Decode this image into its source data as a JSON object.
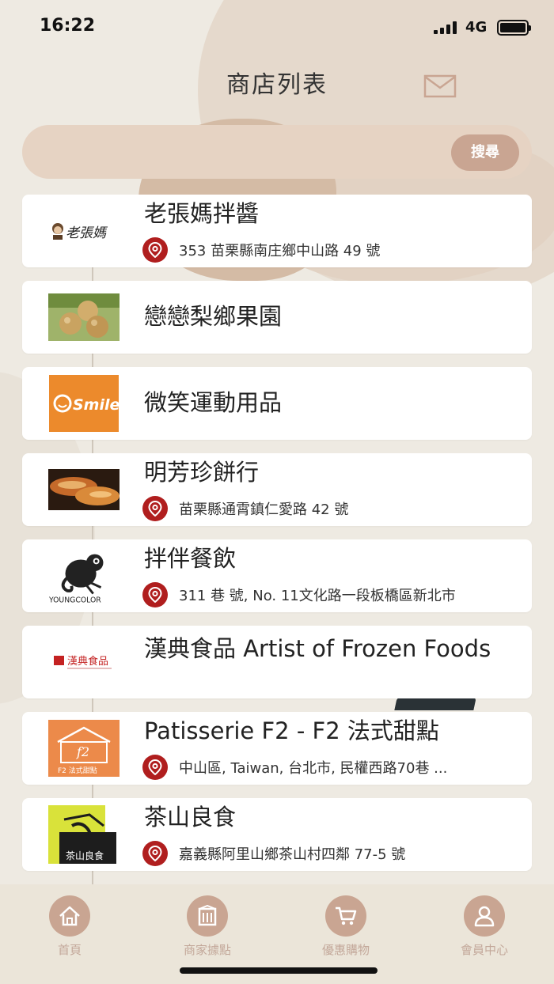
{
  "status": {
    "time": "16:22",
    "network": "4G"
  },
  "header": {
    "title": "商店列表",
    "mail_icon": "mail-icon"
  },
  "search": {
    "value": "",
    "placeholder": "",
    "button": "搜尋"
  },
  "stores": [
    {
      "name": "老張媽拌醬",
      "address": "353 苗栗縣南庄鄉中山路 49 號",
      "logo": "laozhangma-logo",
      "logo_text": "老張媽"
    },
    {
      "name": "戀戀梨鄉果園",
      "address": "",
      "logo": "pear-photo"
    },
    {
      "name": "微笑運動用品",
      "address": "",
      "logo": "smile-logo",
      "logo_text": "Smile"
    },
    {
      "name": "明芳珍餅行",
      "address": "苗栗縣通霄鎮仁愛路 42 號",
      "logo": "pastry-photo"
    },
    {
      "name": "拌伴餐飲",
      "address": "311 巷 號, No. 11文化路一段板橋區新北市",
      "logo": "youngcolor-logo",
      "logo_text": "YOUNGCOLOR"
    },
    {
      "name": "漢典食品 Artist of Frozen Foods",
      "address": "",
      "logo": "handian-logo",
      "logo_text": "漢典食品"
    },
    {
      "name": "Patisserie F2 - F2 法式甜點",
      "address": "中山區, Taiwan, 台北市, 民權西路70巷 ...",
      "logo": "f2-logo",
      "logo_text": "F2 法式甜點"
    },
    {
      "name": "茶山良食",
      "address": "嘉義縣阿里山鄉茶山村四鄰 77-5 號",
      "logo": "chashan-logo",
      "logo_text": "茶山良食"
    }
  ],
  "tabs": [
    {
      "label": "首頁",
      "icon": "home-icon"
    },
    {
      "label": "商家據點",
      "icon": "building-icon"
    },
    {
      "label": "優惠購物",
      "icon": "cart-icon"
    },
    {
      "label": "會員中心",
      "icon": "user-icon"
    }
  ],
  "colors": {
    "accent": "#c9a592",
    "pin": "#b01e1e",
    "background": "#eeeae2"
  }
}
